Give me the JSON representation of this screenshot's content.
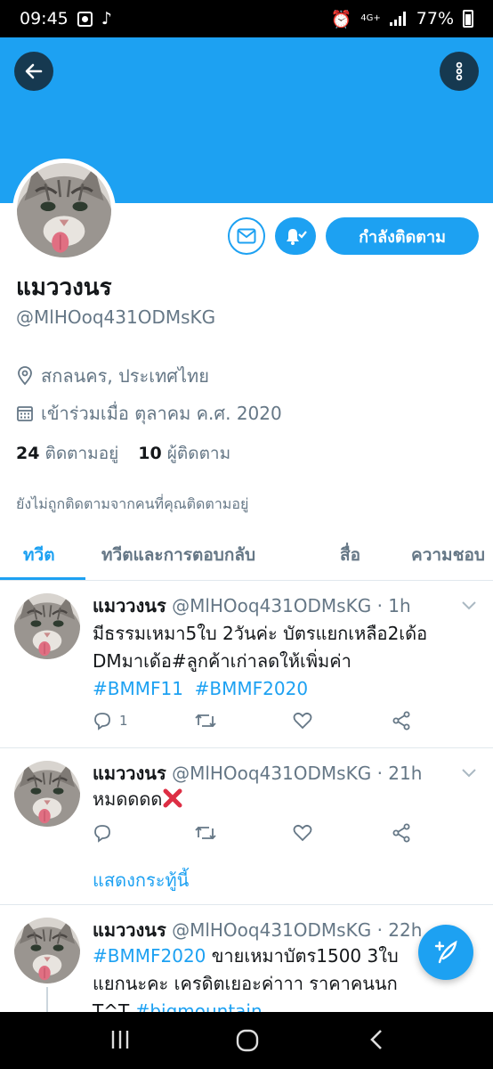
{
  "status_bar": {
    "time": "09:45",
    "network": "4G+",
    "battery": "77%"
  },
  "profile": {
    "name": "แมววงนร",
    "handle": "@MlHOoq431ODMsKG",
    "follow_button": "กำลังติดตาม",
    "location": "สกลนคร, ประเทศไทย",
    "joined": "เข้าร่วมเมื่อ ตุลาคม ค.ศ. 2020",
    "following_count": "24",
    "following_label": "ติดตามอยู่",
    "followers_count": "10",
    "followers_label": "ผู้ติดตาม",
    "not_followed_text": "ยังไม่ถูกติดตามจากคนที่คุณติดตามอยู่"
  },
  "tabs": [
    {
      "label": "ทวีต",
      "active": true
    },
    {
      "label": "ทวีตและการตอบกลับ",
      "active": false
    },
    {
      "label": "สื่อ",
      "active": false
    },
    {
      "label": "ความชอบ",
      "active": false
    }
  ],
  "tweets": [
    {
      "name": "แมววงนร",
      "handle_time": "@MlHOoq431ODMsKG · 1h",
      "line1": "มีธรรมเหมา5ใบ 2วันค่ะ  บัตรแยกเหลือ2เด้อ",
      "line2": "DMมาเด้อ#ลูกค้าเก่าลดให้เพิ่มค่า",
      "tag1": "#BMMF11",
      "tag2": "#BMMF2020",
      "reply_count": "1"
    },
    {
      "name": "แมววงนร",
      "handle_time": "@MlHOoq431ODMsKG · 21h",
      "text": "หมดดดด",
      "show_thread": "แสดงกระทู้นี้"
    },
    {
      "name": "แมววงนร",
      "handle_time": "@MlHOoq431ODMsKG · 22h",
      "tag": "#BMMF2020",
      "line1_rest": " ขายเหมาบัตร1500 3ใบ",
      "line2": "แยกนะคะ เครดิตเยอะค่าาา ราคาคนนก",
      "line3_prefix": "T^T ",
      "line3_tag": "#bigmountain"
    }
  ],
  "colors": {
    "accent": "#1da1f2",
    "text_secondary": "#657786",
    "divider": "#e1e8ed",
    "like_red": "#e0245e"
  },
  "icons": {
    "back": "arrow-left-icon",
    "more": "vertical-dots-icon",
    "message": "envelope-icon",
    "notify": "bell-check-icon",
    "location": "location-pin-icon",
    "calendar": "calendar-icon",
    "reply": "speech-bubble-icon",
    "retweet": "retweet-icon",
    "like": "heart-icon",
    "share": "share-icon",
    "compose": "feather-plus-icon"
  }
}
